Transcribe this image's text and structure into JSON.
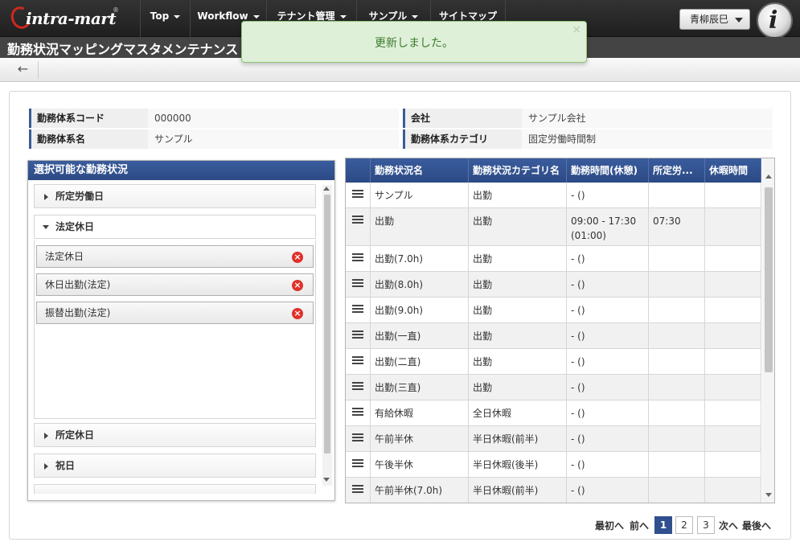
{
  "nav": {
    "logo": "intra-mart",
    "items": [
      {
        "label": "Top",
        "caret": true
      },
      {
        "label": "Workflow",
        "caret": true
      },
      {
        "label": "テナント管理",
        "caret": true
      },
      {
        "label": "サンプル",
        "caret": true
      },
      {
        "label": "サイトマップ",
        "caret": false
      }
    ],
    "user": "青柳辰巳"
  },
  "page": {
    "title": "勤務状況マッピングマスタメンテナンス"
  },
  "toast": {
    "message": "更新しました。",
    "close": "×"
  },
  "info": {
    "code_label": "勤務体系コード",
    "code_value": "000000",
    "company_label": "会社",
    "company_value": "サンプル会社",
    "name_label": "勤務体系名",
    "name_value": "サンプル",
    "category_label": "勤務体系カテゴリ",
    "category_value": "固定労働時間制"
  },
  "left": {
    "header": "選択可能な勤務状況",
    "sections": [
      "所定労働日",
      "法定休日",
      "所定休日",
      "祝日"
    ],
    "items": [
      "法定休日",
      "休日出勤(法定)",
      "振替出勤(法定)"
    ]
  },
  "grid": {
    "columns": [
      "勤務状況名",
      "勤務状況カテゴリ名",
      "勤務時間(休憩)",
      "所定労...",
      "休暇時間"
    ],
    "rows": [
      {
        "name": "サンプル",
        "category": "出勤",
        "time": "- ()",
        "scheduled": "",
        "leave": ""
      },
      {
        "name": "出勤",
        "category": "出勤",
        "time": "09:00 - 17:30 (01:00)",
        "scheduled": "07:30",
        "leave": ""
      },
      {
        "name": "出勤(7.0h)",
        "category": "出勤",
        "time": "- ()",
        "scheduled": "",
        "leave": ""
      },
      {
        "name": "出勤(8.0h)",
        "category": "出勤",
        "time": "- ()",
        "scheduled": "",
        "leave": ""
      },
      {
        "name": "出勤(9.0h)",
        "category": "出勤",
        "time": "- ()",
        "scheduled": "",
        "leave": ""
      },
      {
        "name": "出勤(一直)",
        "category": "出勤",
        "time": "- ()",
        "scheduled": "",
        "leave": ""
      },
      {
        "name": "出勤(二直)",
        "category": "出勤",
        "time": "- ()",
        "scheduled": "",
        "leave": ""
      },
      {
        "name": "出勤(三直)",
        "category": "出勤",
        "time": "- ()",
        "scheduled": "",
        "leave": ""
      },
      {
        "name": "有給休暇",
        "category": "全日休暇",
        "time": "- ()",
        "scheduled": "",
        "leave": ""
      },
      {
        "name": "午前半休",
        "category": "半日休暇(前半)",
        "time": "- ()",
        "scheduled": "",
        "leave": ""
      },
      {
        "name": "午後半休",
        "category": "半日休暇(後半)",
        "time": "- ()",
        "scheduled": "",
        "leave": ""
      },
      {
        "name": "午前半休(7.0h)",
        "category": "半日休暇(前半)",
        "time": "- ()",
        "scheduled": "",
        "leave": ""
      }
    ]
  },
  "pager": {
    "first": "最初へ",
    "prev": "前へ",
    "pages": [
      "1",
      "2",
      "3"
    ],
    "current": "1",
    "next": "次へ",
    "last": "最後へ"
  },
  "colors": {
    "header_blue": "#2f4f8f",
    "toast_bg": "#dff0d8",
    "delete_red": "#e0302a"
  }
}
